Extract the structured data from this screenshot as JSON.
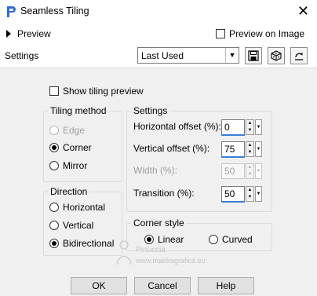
{
  "window": {
    "title": "Seamless Tiling",
    "close_symbol": "✕"
  },
  "preview_bar": {
    "preview_label": "Preview",
    "preview_on_image_label": "Preview on Image",
    "preview_on_image_checked": false
  },
  "settings_bar": {
    "label": "Settings",
    "preset_value": "Last Used"
  },
  "show_tiling_preview": {
    "label": "Show tiling preview",
    "checked": false
  },
  "tiling_method": {
    "title": "Tiling method",
    "options": [
      {
        "label": "Edge",
        "selected": false,
        "disabled": true
      },
      {
        "label": "Corner",
        "selected": true,
        "disabled": false
      },
      {
        "label": "Mirror",
        "selected": false,
        "disabled": false
      }
    ]
  },
  "direction": {
    "title": "Direction",
    "options": [
      {
        "label": "Horizontal",
        "selected": false
      },
      {
        "label": "Vertical",
        "selected": false
      },
      {
        "label": "Bidirectional",
        "selected": true
      }
    ]
  },
  "settings": {
    "title": "Settings",
    "fields": [
      {
        "label": "Horizontal offset (%):",
        "value": "0",
        "disabled": false
      },
      {
        "label": "Vertical offset (%):",
        "value": "75",
        "disabled": false
      },
      {
        "label": "Width (%):",
        "value": "50",
        "disabled": true
      },
      {
        "label": "Transition (%):",
        "value": "50",
        "disabled": false
      }
    ]
  },
  "corner_style": {
    "title": "Corner style",
    "options": [
      {
        "label": "Linear",
        "selected": true
      },
      {
        "label": "Curved",
        "selected": false
      }
    ]
  },
  "watermark": {
    "line1": "Pinuccia",
    "line2": "www.maldragrafica.eu"
  },
  "buttons": {
    "ok": "OK",
    "cancel": "Cancel",
    "help": "Help"
  },
  "icons": {
    "app": "app-logo-icon",
    "close": "close-icon",
    "expand": "expand-triangle-icon",
    "dropdown": "chevron-down-icon",
    "save": "save-preset-icon",
    "random": "randomize-dice-icon",
    "reset": "reset-icon",
    "spin": "spin-arrows-icon",
    "slider": "slider-popup-icon"
  },
  "colors": {
    "accent_underline": "#3a7fd5",
    "app_icon": "#2e6fd6"
  }
}
